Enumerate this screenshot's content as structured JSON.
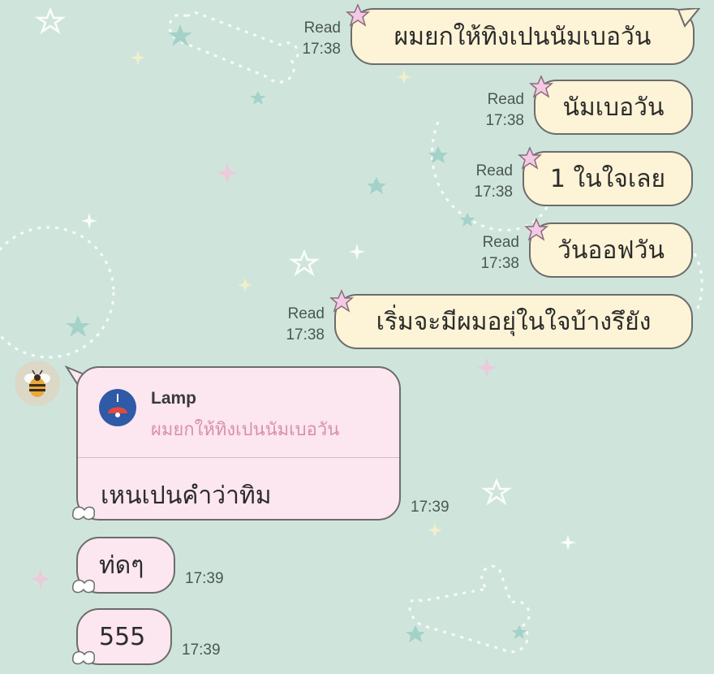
{
  "theme": {
    "background": "#cfe5dc",
    "outgoing_bubble": "#fdf3d6",
    "incoming_bubble": "#fce6ef",
    "bubble_border": "#6c6c6c",
    "accent_star": "#f3c9e3",
    "reply_quote_color": "#d98fae",
    "lamp_icon_color": "#2e5aa7"
  },
  "outgoing": [
    {
      "text": "ผมยกให้ทิงเปนนัมเบอวัน",
      "status": "Read",
      "time": "17:38"
    },
    {
      "text": "นัมเบอวัน",
      "status": "Read",
      "time": "17:38"
    },
    {
      "text": "1 ในใจเลย",
      "status": "Read",
      "time": "17:38"
    },
    {
      "text": "วันออฟวัน",
      "status": "Read",
      "time": "17:38"
    },
    {
      "text": "เริ่มจะมีผมอยุ่ในใจบ้างรึยัง",
      "status": "Read",
      "time": "17:38"
    }
  ],
  "incoming": {
    "avatar_icon": "bee-icon",
    "reply_message": {
      "quoted_name": "Lamp",
      "quoted_icon": "lamp-icon",
      "quoted_text": "ผมยกให้ทิงเปนนัมเบอวัน",
      "text": "เหนเปนคำว่าทิม",
      "time": "17:39"
    },
    "messages": [
      {
        "text": "ท่ดๆ",
        "time": "17:39"
      },
      {
        "text": "555",
        "time": "17:39"
      }
    ]
  }
}
